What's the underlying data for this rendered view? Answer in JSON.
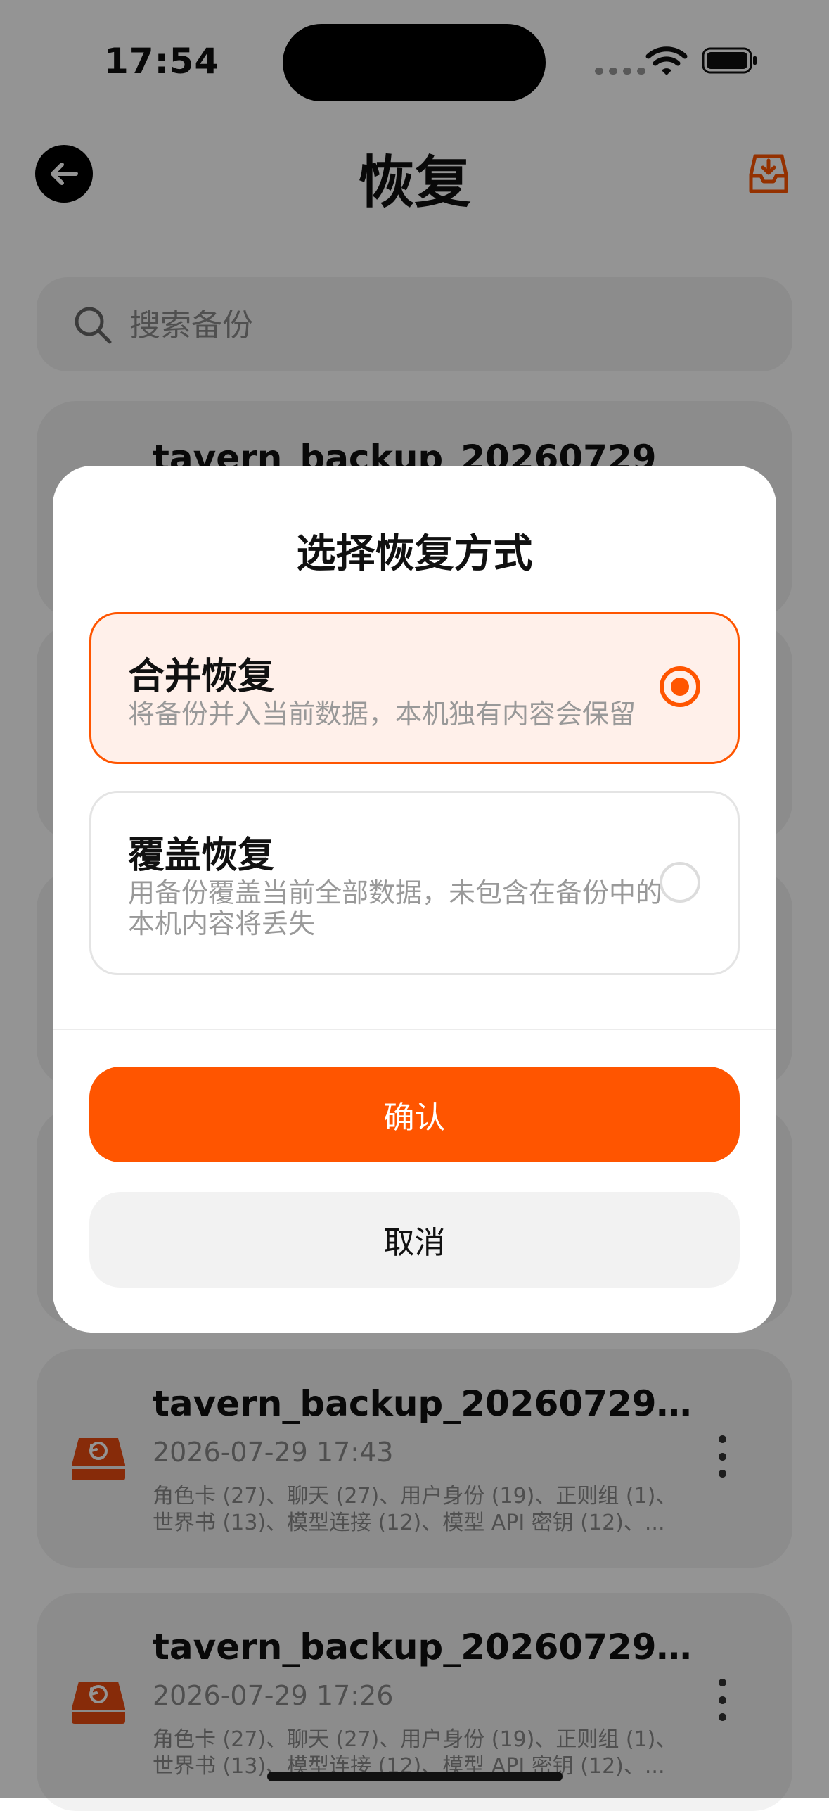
{
  "status_bar": {
    "time": "17:54"
  },
  "header": {
    "title": "恢复"
  },
  "search": {
    "placeholder": "搜索备份"
  },
  "backups": [
    {
      "name": "tavern_backup_20260729",
      "date": "",
      "summary_line1": "",
      "summary_line2": ""
    },
    {
      "name": "tavern_backup_20260729_...",
      "date": "2026-07-29 17:43",
      "summary_line1": "角色卡 (27)、聊天 (27)、用户身份 (19)、正则组 (1)、",
      "summary_line2": "世界书 (13)、模型连接 (12)、模型 API 密钥 (12)、..."
    },
    {
      "name": "tavern_backup_20260729_...",
      "date": "2026-07-29 17:26",
      "summary_line1": "角色卡 (27)、聊天 (27)、用户身份 (19)、正则组 (1)、",
      "summary_line2": "世界书 (13)、模型连接 (12)、模型 API 密钥 (12)、..."
    }
  ],
  "dialog": {
    "title": "选择恢复方式",
    "options": [
      {
        "title": "合并恢复",
        "description": "将备份并入当前数据，本机独有内容会保留",
        "selected": true
      },
      {
        "title": "覆盖恢复",
        "description": "用备份覆盖当前全部数据，未包含在备份中的本机内容将丢失",
        "selected": false
      }
    ],
    "confirm_label": "确认",
    "cancel_label": "取消"
  },
  "colors": {
    "accent": "#ff5500",
    "accent_bg": "#fff0ea",
    "card_bg": "#f2f2f2",
    "overlay": "rgba(0,0,0,0.42)"
  },
  "icons": {
    "back": "arrow-left-icon",
    "header_action": "inbox-download-icon",
    "search": "search-icon",
    "backup": "backup-drive-icon",
    "more": "more-vertical-icon"
  }
}
